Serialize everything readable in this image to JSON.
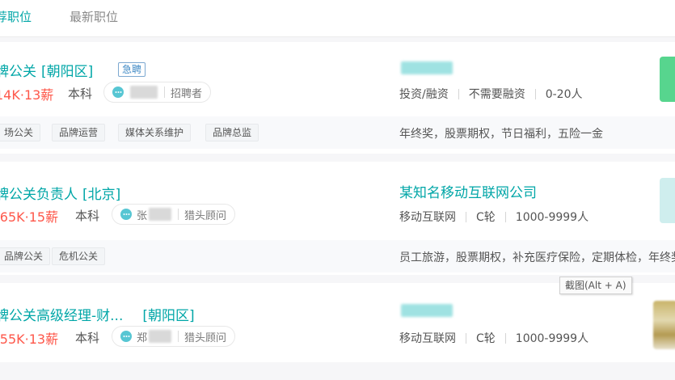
{
  "tabs": [
    {
      "label": "荐职位",
      "active": true
    },
    {
      "label": "最新职位",
      "active": false
    }
  ],
  "jobs": [
    {
      "title": "牌公关",
      "area": "[朝阳区]",
      "urgent": "急聘",
      "salary": "14K·13薪",
      "education": "本科",
      "recruiter_role": "招聘者",
      "company_info": [
        "投资/融资",
        "不需要融资",
        "0-20人"
      ],
      "tags": [
        "场公关",
        "品牌运营",
        "媒体关系维护",
        "品牌总监"
      ],
      "welfare": "年终奖，股票期权，节日福利，五险一金"
    },
    {
      "title": "牌公关负责人",
      "area": "[北京]",
      "salary": "-65K·15薪",
      "education": "本科",
      "recruiter_name": "张",
      "recruiter_role": "猎头顾问",
      "company": "某知名移动互联网公司",
      "company_info": [
        "移动互联网",
        "C轮",
        "1000-9999人"
      ],
      "tags": [
        "品牌公关",
        "危机公关"
      ],
      "welfare": "员工旅游，股票期权，补充医疗保险，定期体检，年终奖"
    },
    {
      "title": "牌公关高级经理-财...",
      "area": "[朝阳区]",
      "salary": "-55K·13薪",
      "education": "本科",
      "recruiter_name": "郑",
      "recruiter_role": "猎头顾问",
      "company_info": [
        "移动互联网",
        "C轮",
        "1000-9999人"
      ]
    }
  ],
  "tooltip": "截图(Alt + A)",
  "icons": {
    "chat": "chat-bubble-icon"
  },
  "colors": {
    "accent": "#00a6a7",
    "salary": "#fe574a"
  }
}
